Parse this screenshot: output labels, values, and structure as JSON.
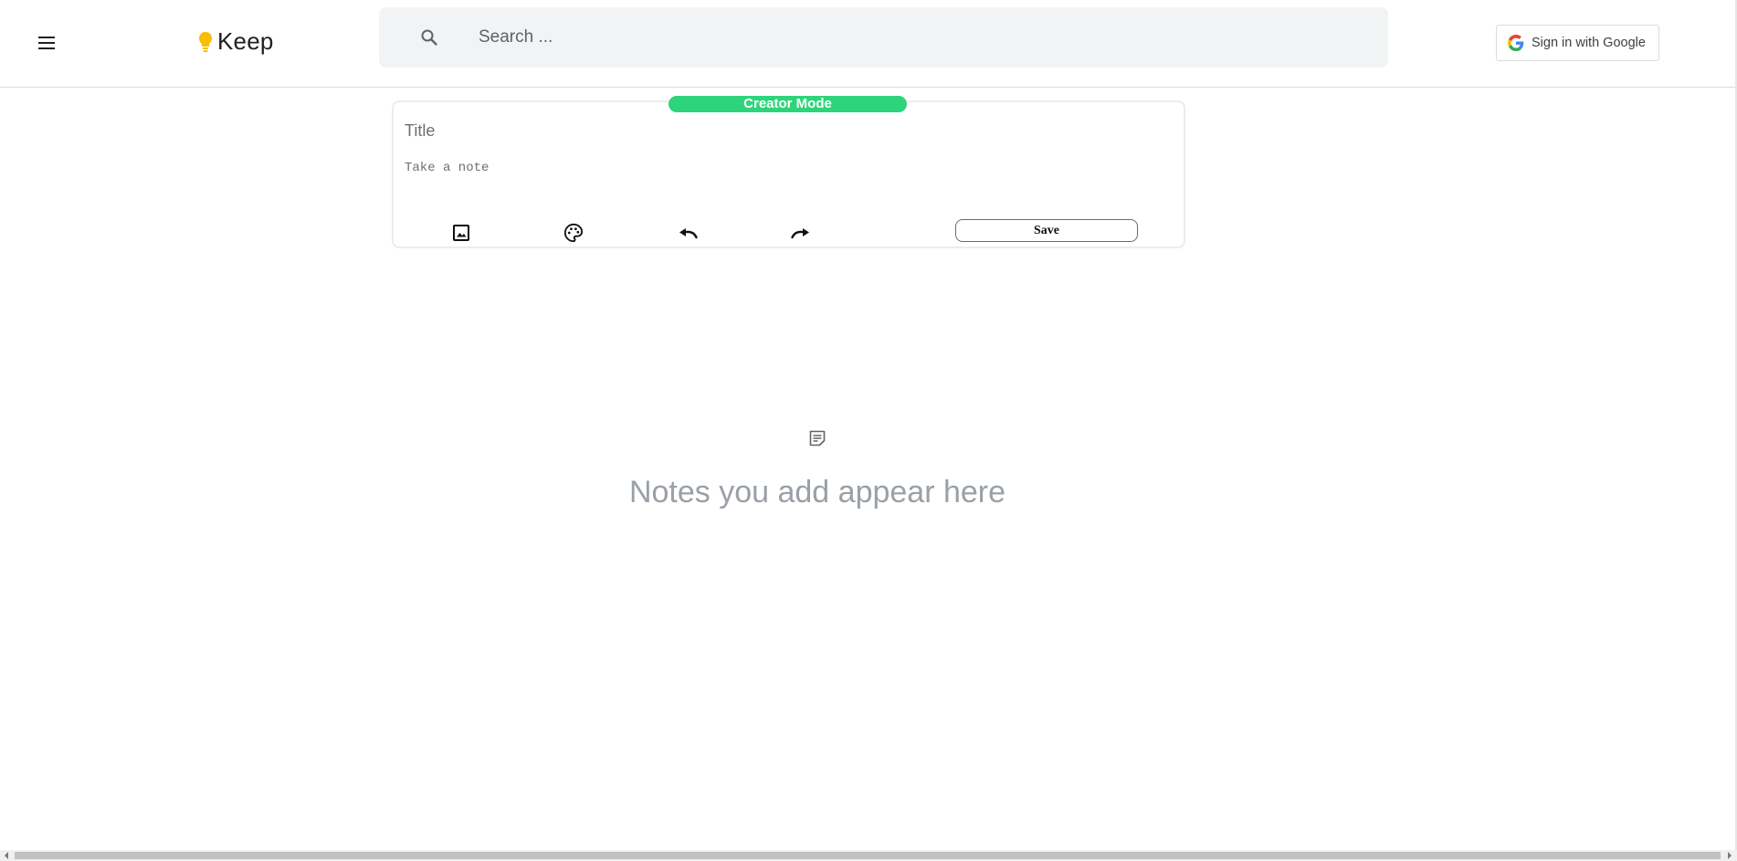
{
  "header": {
    "app_name": "Keep",
    "search": {
      "placeholder": "Search ..."
    },
    "signin_label": "Sign in with Google"
  },
  "creator": {
    "badge": "Creator Mode",
    "title_placeholder": "Title",
    "note_placeholder": "Take a note",
    "save_label": "Save",
    "tools": [
      "image-icon",
      "palette-icon",
      "undo-icon",
      "redo-icon"
    ]
  },
  "empty_state": {
    "icon": "note-icon",
    "message": "Notes you add appear here"
  },
  "colors": {
    "badge": "#2ed47a",
    "logo_bulb": "#fbbc04",
    "search_bg": "#f1f3f4",
    "empty_text": "#9aa0a6"
  }
}
